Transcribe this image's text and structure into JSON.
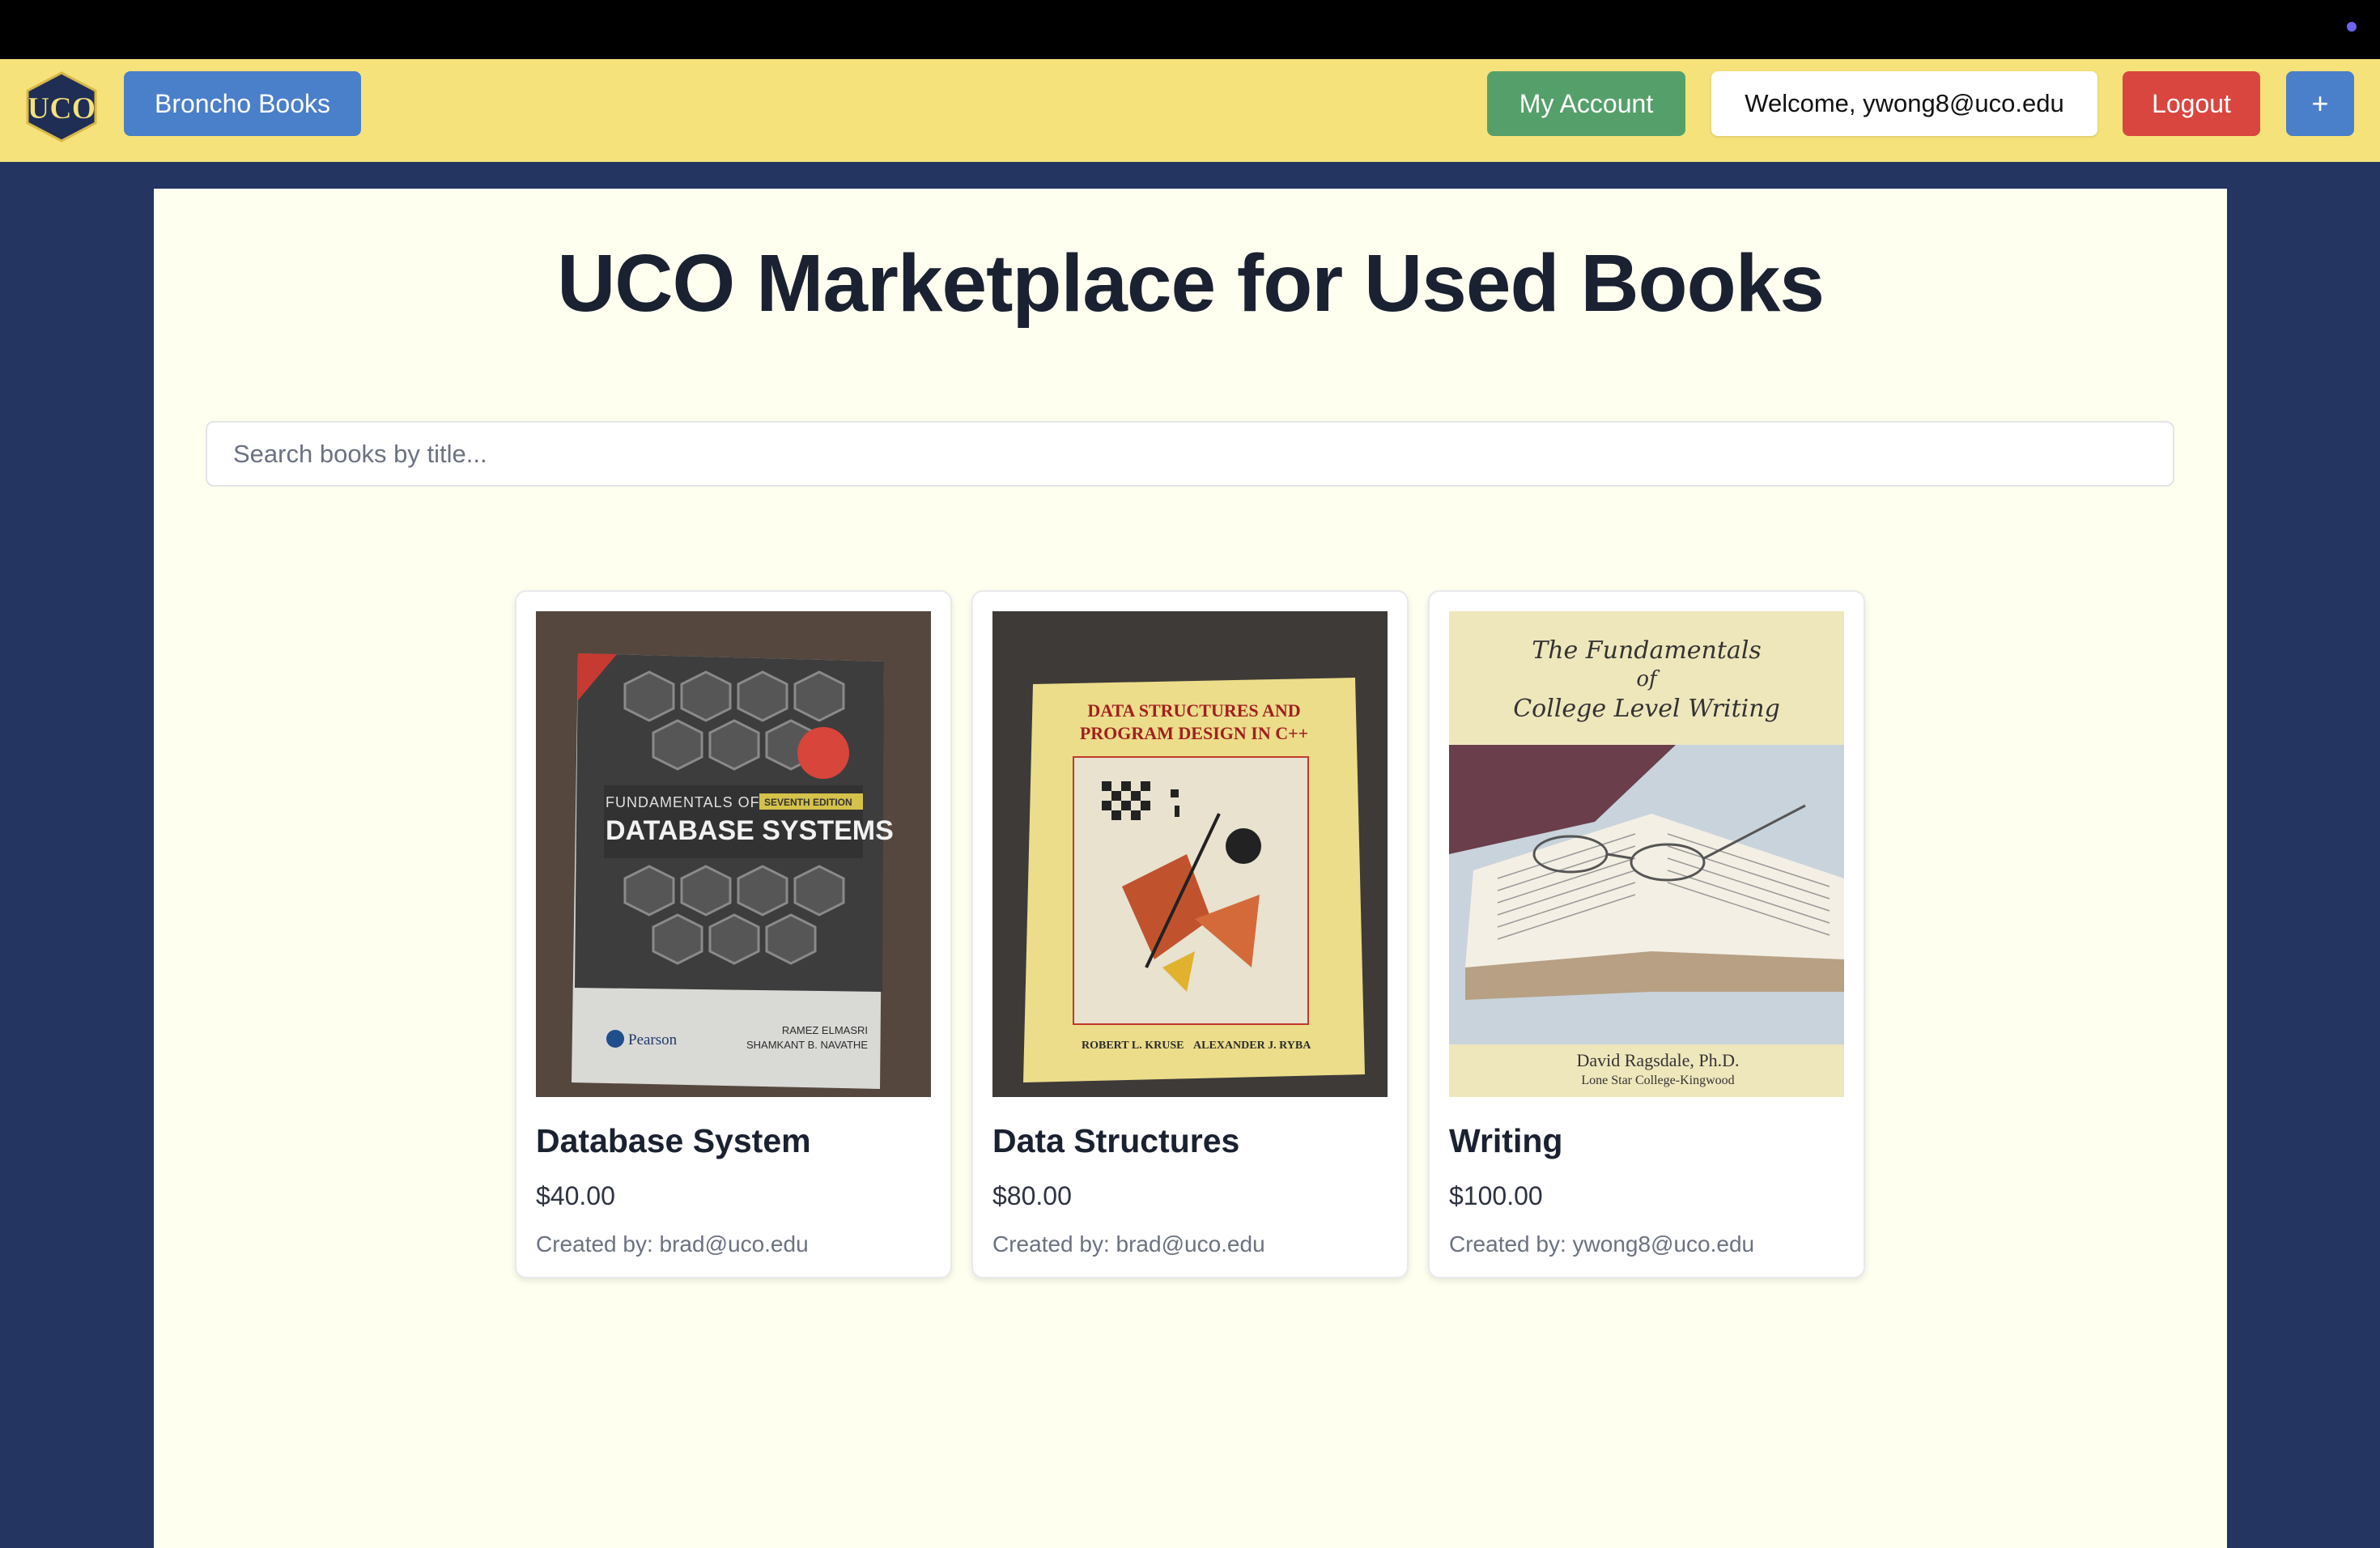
{
  "navbar": {
    "brand_label": "Broncho Books",
    "logo_text": "UCO",
    "account_label": "My Account",
    "welcome_text": "Welcome, ywong8@uco.edu",
    "logout_label": "Logout",
    "add_label": "+"
  },
  "main": {
    "title": "UCO Marketplace for Used Books",
    "search": {
      "placeholder": "Search books by title...",
      "value": ""
    },
    "creator_prefix": "Created by: ",
    "books": [
      {
        "title": "Database System",
        "price": "$40.00",
        "creator": "brad@uco.edu",
        "cover": {
          "line1": "FUNDAMENTALS OF",
          "line2": "DATABASE SYSTEMS",
          "edition": "SEVENTH EDITION",
          "publisher": "Pearson",
          "author1": "RAMEZ ELMASRI",
          "author2": "SHAMKANT B. NAVATHE"
        }
      },
      {
        "title": "Data Structures",
        "price": "$80.00",
        "creator": "brad@uco.edu",
        "cover": {
          "line1": "DATA STRUCTURES AND",
          "line2": "PROGRAM DESIGN IN C++",
          "author1": "ROBERT L. KRUSE",
          "author2": "ALEXANDER J. RYBA"
        }
      },
      {
        "title": "Writing",
        "price": "$100.00",
        "creator": "ywong8@uco.edu",
        "cover": {
          "line1": "The Fundamentals",
          "line2": "of",
          "line3": "College Level Writing",
          "author1": "David Ragsdale, Ph.D.",
          "author2": "Lone Star College-Kingwood"
        }
      }
    ]
  },
  "colors": {
    "navbar_bg": "#f6e27a",
    "page_bg": "#233560",
    "main_bg": "#fffff0",
    "brand_button": "#4a7fc9",
    "account_button": "#55a06a",
    "logout_button": "#d9463f"
  }
}
